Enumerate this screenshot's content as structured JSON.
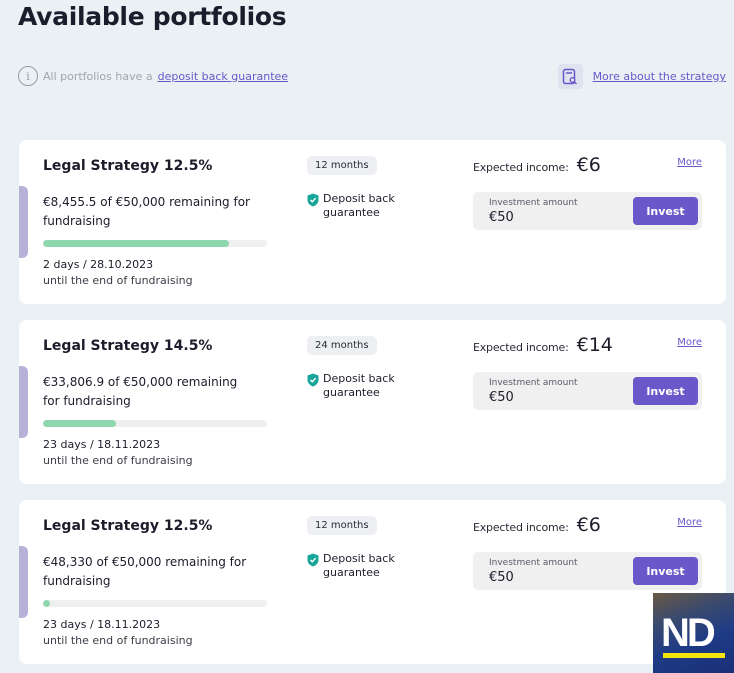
{
  "header": {
    "title": "Available portfolios",
    "info_text": "All portfolios have a",
    "info_link": "deposit back guarantee",
    "strategy_link": "More about the strategy"
  },
  "colors": {
    "accent": "#6a57c9",
    "progress": "#8dd6ae",
    "shield": "#1aa59a",
    "background": "#e9f1f5"
  },
  "portfolios": [
    {
      "title": "Legal Strategy 12.5%",
      "remaining_text": "€8,455.5 of €50,000 remaining for fundraising",
      "raised_fraction": 0.831,
      "days_text": "2 days / 28.10.2023",
      "until_text": "until the end of fundraising",
      "term": "12 months",
      "guarantee": "Deposit back guarantee",
      "income_label": "Expected income:",
      "income_value": "€6",
      "more_label": "More",
      "investment_label": "Investment amount",
      "investment_value": "€50",
      "invest_button": "Invest"
    },
    {
      "title": "Legal Strategy 14.5%",
      "remaining_text": "€33,806.9 of €50,000 remaining for fundraising",
      "raised_fraction": 0.324,
      "days_text": "23 days / 18.11.2023",
      "until_text": "until the end of fundraising",
      "term": "24 months",
      "guarantee": "Deposit back guarantee",
      "income_label": "Expected income:",
      "income_value": "€14",
      "more_label": "More",
      "investment_label": "Investment amount",
      "investment_value": "€50",
      "invest_button": "Invest"
    },
    {
      "title": "Legal Strategy 12.5%",
      "remaining_text": "€48,330 of €50,000 remaining for fundraising",
      "raised_fraction": 0.033,
      "days_text": "23 days / 18.11.2023",
      "until_text": "until the end of fundraising",
      "term": "12 months",
      "guarantee": "Deposit back guarantee",
      "income_label": "Expected income:",
      "income_value": "€6",
      "more_label": "More",
      "investment_label": "Investment amount",
      "investment_value": "€50",
      "invest_button": "Invest"
    }
  ],
  "watermark": {
    "text": "ND"
  }
}
